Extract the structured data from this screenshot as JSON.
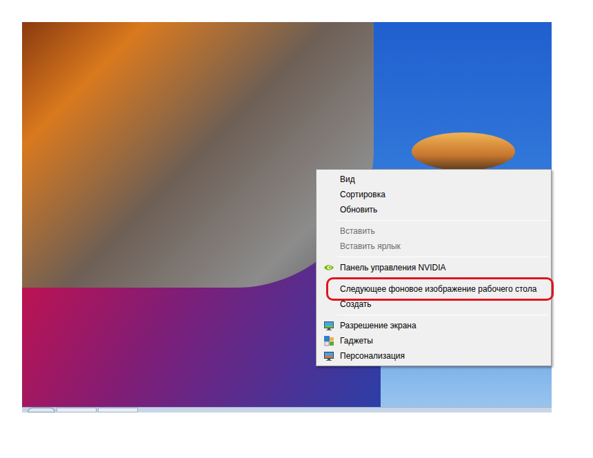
{
  "menu": {
    "items": [
      {
        "kind": "plain",
        "label": "Вид",
        "disabled": false,
        "highlighted": false
      },
      {
        "kind": "plain",
        "label": "Сортировка",
        "disabled": false,
        "highlighted": false
      },
      {
        "kind": "plain",
        "label": "Обновить",
        "disabled": false,
        "highlighted": false
      },
      {
        "kind": "separator"
      },
      {
        "kind": "plain",
        "label": "Вставить",
        "disabled": true,
        "highlighted": false
      },
      {
        "kind": "plain",
        "label": "Вставить ярлык",
        "disabled": true,
        "highlighted": false
      },
      {
        "kind": "separator"
      },
      {
        "kind": "nvidia",
        "label": "Панель управления NVIDIA",
        "disabled": false,
        "highlighted": false
      },
      {
        "kind": "separator"
      },
      {
        "kind": "plain",
        "label": "Следующее фоновое изображение рабочего стола",
        "disabled": false,
        "highlighted": true
      },
      {
        "kind": "plain",
        "label": "Создать",
        "disabled": false,
        "highlighted": false
      },
      {
        "kind": "separator"
      },
      {
        "kind": "display",
        "label": "Разрешение экрана",
        "disabled": false,
        "highlighted": false
      },
      {
        "kind": "gadgets",
        "label": "Гаджеты",
        "disabled": false,
        "highlighted": false
      },
      {
        "kind": "personalize",
        "label": "Персонализация",
        "disabled": false,
        "highlighted": false
      }
    ]
  }
}
